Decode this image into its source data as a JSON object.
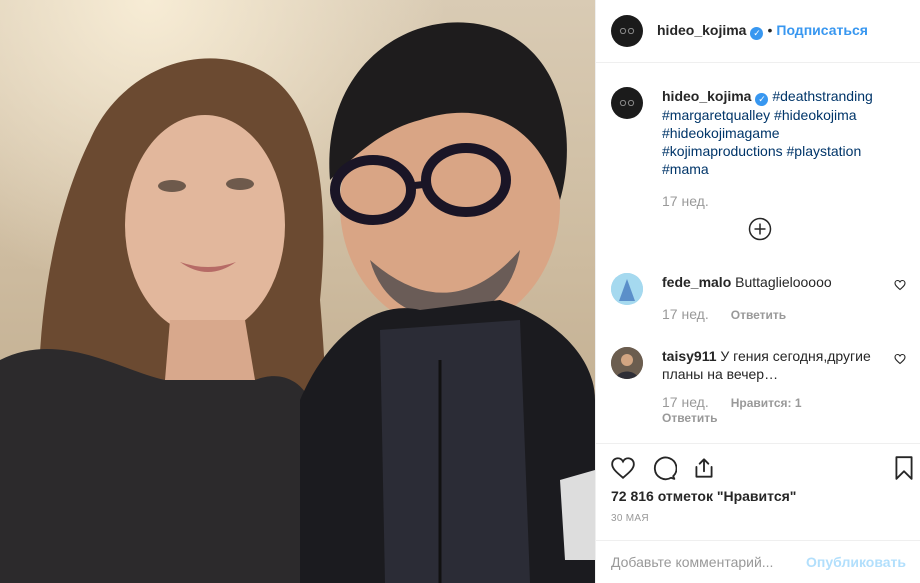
{
  "post": {
    "author": "hideo_kojima",
    "follow_label": "Подписаться",
    "dot": "•"
  },
  "caption": {
    "author": "hideo_kojima",
    "line1": "#deathstranding",
    "line2": "#margaretqualley #hideokojima",
    "line3": "#hideokojimagame",
    "line4": "#kojimaproductions #playstation",
    "line5": "#mama",
    "time": "17 нед."
  },
  "comments": [
    {
      "user": "fede_malo",
      "text": "Buttaglielooooo",
      "time": "17 нед.",
      "reply_label": "Ответить"
    },
    {
      "user": "taisy911",
      "text_line1": "У гения сегодня,другие",
      "text_line2": "планы на вечер…",
      "time": "17 нед.",
      "likes_label": "Нравится: 1",
      "reply_label": "Ответить"
    }
  ],
  "likes_text": "72 816 отметок \"Нравится\"",
  "date": "30 МАЯ",
  "add_comment": {
    "placeholder": "Добавьте комментарий...",
    "publish_label": "Опубликовать"
  },
  "colors": {
    "accent": "#3897f0",
    "hashtag": "#003569",
    "muted": "#999999",
    "publish_disabled": "#b2dffc"
  },
  "icons": [
    "heart-icon",
    "comment-icon",
    "share-icon",
    "bookmark-icon",
    "plus-circle-icon",
    "verified-icon"
  ]
}
